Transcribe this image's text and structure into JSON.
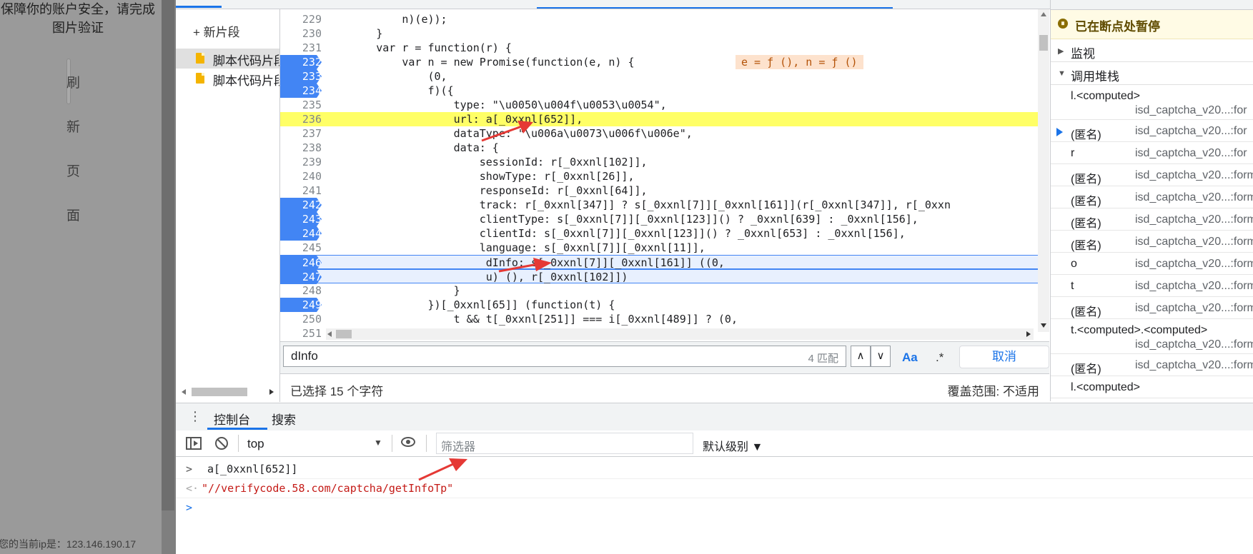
{
  "captcha": {
    "message": "保障你的账户安全，请完成图片验证",
    "refresh_chars": [
      "刷",
      "新",
      "页",
      "面"
    ],
    "ip_text": "您的当前ip是：123.146.190.17"
  },
  "snippets": {
    "new_label": "+ 新片段",
    "items": [
      "脚本代码片段",
      "脚本代码片段"
    ]
  },
  "editor": {
    "lines": [
      {
        "n": "229",
        "code": "            n)(e));",
        "bp": false
      },
      {
        "n": "230",
        "code": "        }",
        "bp": false
      },
      {
        "n": "231",
        "code": "        var r = function(r) {",
        "bp": false
      },
      {
        "n": "232",
        "code": "            var n = new Promise(function(e, n) {",
        "bp": true
      },
      {
        "n": "233",
        "code": "                (0,",
        "bp": true
      },
      {
        "n": "234",
        "code": "                f)({",
        "bp": true
      },
      {
        "n": "235",
        "code": "                    type: \"\\u0050\\u004f\\u0053\\u0054\",",
        "bp": false
      },
      {
        "n": "236",
        "code": "                    url: a[_0xxnl[652]],",
        "bp": false
      },
      {
        "n": "237",
        "code": "                    dataType: \"\\u006a\\u0073\\u006f\\u006e\",",
        "bp": false
      },
      {
        "n": "238",
        "code": "                    data: {",
        "bp": false
      },
      {
        "n": "239",
        "code": "                        sessionId: r[_0xxnl[102]],",
        "bp": false
      },
      {
        "n": "240",
        "code": "                        showType: r[_0xxnl[26]],",
        "bp": false
      },
      {
        "n": "241",
        "code": "                        responseId: r[_0xxnl[64]],",
        "bp": false
      },
      {
        "n": "242",
        "code": "                        track: r[_0xxnl[347]] ? s[_0xxnl[7]][_0xxnl[161]](r[_0xxnl[347]], r[_0xxn",
        "bp": true
      },
      {
        "n": "243",
        "code": "                        clientType: s[_0xxnl[7]][_0xxnl[123]]() ? _0xxnl[639] : _0xxnl[156],",
        "bp": true
      },
      {
        "n": "244",
        "code": "                        clientId: s[_0xxnl[7]][_0xxnl[123]]() ? _0xxnl[653] : _0xxnl[156],",
        "bp": true
      },
      {
        "n": "245",
        "code": "                        language: s[_0xxnl[7]][_0xxnl[11]],",
        "bp": false
      },
      {
        "n": "246",
        "code": "                         dInfo: s[_0xxnl[7]][_0xxnl[161]] ((0,",
        "bp": true
      },
      {
        "n": "247",
        "code": "                         u) (), r[_0xxnl[102]])",
        "bp": true
      },
      {
        "n": "248",
        "code": "                    }",
        "bp": false
      },
      {
        "n": "249",
        "code": "                })[_0xxnl[65]] (function(t) {",
        "bp": true
      },
      {
        "n": "250",
        "code": "                    t && t[_0xxnl[251]] === i[_0xxnl[489]] ? (0,",
        "bp": false
      },
      {
        "n": "251",
        "code": "",
        "bp": false
      }
    ],
    "inline_values": "e = ƒ (), n = ƒ ()"
  },
  "find": {
    "query": "dInfo",
    "match_count": "4 匹配",
    "match_case_label": "Aa",
    "regex_label": ".*",
    "cancel_label": "取消",
    "prev_label": "∧",
    "next_label": "∨"
  },
  "status": {
    "selection": "已选择 15 个字符",
    "coverage": "覆盖范围: 不适用"
  },
  "debugger": {
    "paused": "已在断点处暂停",
    "watch": "监视",
    "call_stack": "调用堆栈",
    "frames": [
      {
        "fn": "l.<computed>",
        "loc": "isd_captcha_v20...:for",
        "two": true
      },
      {
        "fn": "(匿名)",
        "loc": "isd_captcha_v20...:for",
        "two": false,
        "current": true
      },
      {
        "fn": "r",
        "loc": "isd_captcha_v20...:for",
        "two": false
      },
      {
        "fn": "(匿名)",
        "loc": "isd_captcha_v20...:form",
        "two": false
      },
      {
        "fn": "(匿名)",
        "loc": "isd_captcha_v20...:form",
        "two": false
      },
      {
        "fn": "(匿名)",
        "loc": "isd_captcha_v20...:form",
        "two": false
      },
      {
        "fn": "(匿名)",
        "loc": "isd_captcha_v20...:form",
        "two": false
      },
      {
        "fn": "o",
        "loc": "isd_captcha_v20...:form",
        "two": false
      },
      {
        "fn": "t",
        "loc": "isd_captcha_v20...:form",
        "two": false
      },
      {
        "fn": "(匿名)",
        "loc": "isd_captcha_v20...:form",
        "two": false
      },
      {
        "fn": "t.<computed>.<computed>",
        "loc": "isd_captcha_v20...:form",
        "two": true
      },
      {
        "fn": "(匿名)",
        "loc": "isd_captcha_v20...:form",
        "two": false
      },
      {
        "fn": "l.<computed>",
        "loc": "",
        "two": false
      }
    ]
  },
  "drawer": {
    "tab_console": "控制台",
    "tab_search": "搜索",
    "context": "top",
    "filter_placeholder": "筛选器",
    "level": "默认级别 ▼",
    "input_expr": "a[_0xxnl[652]]",
    "output_value": "\"//verifycode.58.com/captcha/getInfoTp\""
  }
}
